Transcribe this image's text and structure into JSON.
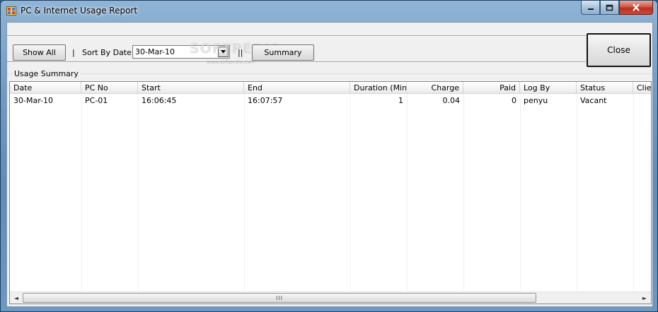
{
  "window": {
    "title": "PC & Internet Usage Report",
    "controls": {
      "minimize": "–",
      "maximize": "□",
      "close": "✕"
    }
  },
  "toolbar": {
    "show_all_label": "Show All",
    "separator1": "|",
    "sort_by_date_label": "Sort By Date",
    "date_value": "30-Mar-10",
    "separator2": "||",
    "summary_label": "Summary",
    "close_label": "Close",
    "watermark": "SOFTPEDIA",
    "watermark_sub": "www.softpedia.com"
  },
  "group": {
    "label": "Usage Summary"
  },
  "grid": {
    "columns": [
      {
        "label": "Date",
        "align": "left"
      },
      {
        "label": "PC No",
        "align": "left"
      },
      {
        "label": "Start",
        "align": "left"
      },
      {
        "label": "End",
        "align": "left"
      },
      {
        "label": "Duration (Min)",
        "align": "right"
      },
      {
        "label": "Charge",
        "align": "right"
      },
      {
        "label": "Paid",
        "align": "right"
      },
      {
        "label": "Log By",
        "align": "left"
      },
      {
        "label": "Status",
        "align": "left"
      },
      {
        "label": "Client",
        "align": "left"
      }
    ],
    "rows": [
      [
        "30-Mar-10",
        "PC-01",
        "16:06:45",
        "16:07:57",
        "1",
        "0.04",
        "0",
        "penyu",
        "Vacant",
        ""
      ]
    ]
  },
  "scrollbar": {
    "grip": "III",
    "left_arrow": "◄",
    "right_arrow": "►"
  },
  "icons": {
    "app": "app-icon",
    "dropdown": "chevron-down-icon"
  }
}
